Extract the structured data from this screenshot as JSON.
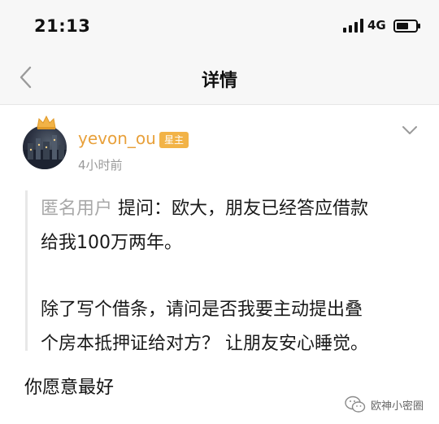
{
  "status_bar": {
    "time": "21:13",
    "network": "4G",
    "icons": [
      "signal-icon",
      "battery-icon"
    ]
  },
  "nav": {
    "title": "详情",
    "back_icon": "back-icon"
  },
  "post": {
    "username": "yevon_ou",
    "badge": "星主",
    "time": "4小时前",
    "avatar_icon": "crown-icon",
    "more_icon": "chevron-down-icon",
    "accent_color": "#e8a03a"
  },
  "question": {
    "author": "匿名用户",
    "line1": "提问：欧大，朋友已经答应借款",
    "line2": "给我100万两年。",
    "line3": "除了写个借条，请问是否我要主动提出叠",
    "line4": "个房本抵押证给对方？ 让朋友安心睡觉。"
  },
  "answer": {
    "text": "你愿意最好"
  },
  "watermark": {
    "text": "欧神小密圈"
  }
}
